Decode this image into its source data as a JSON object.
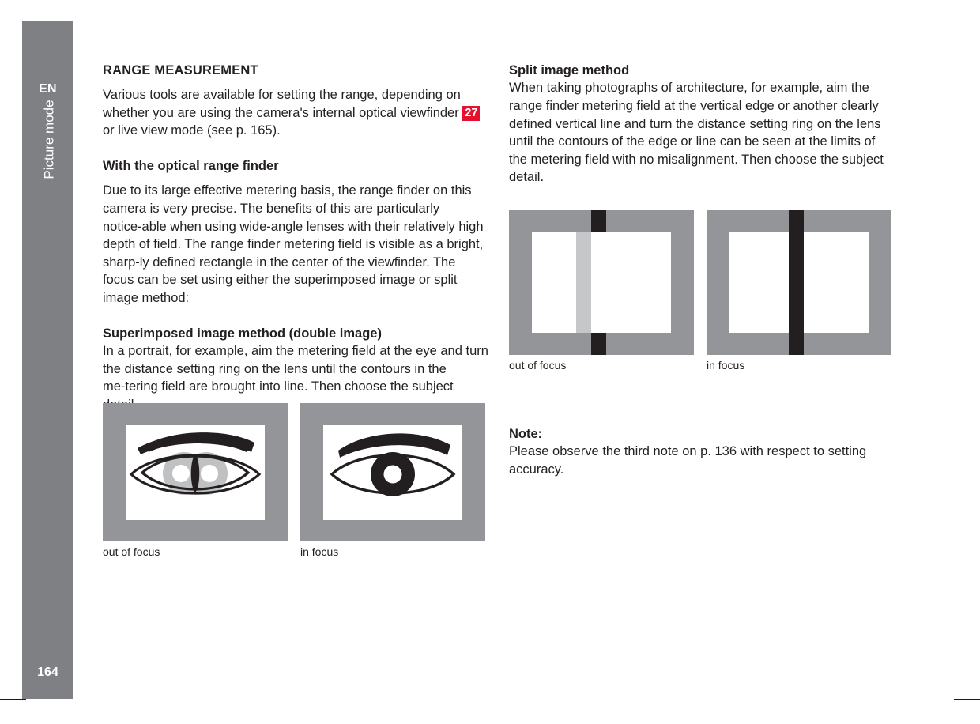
{
  "sidebar": {
    "language": "EN",
    "chapter": "Picture mode",
    "page_number": "164",
    "color": "#7e8083"
  },
  "colors": {
    "accent_red": "#e8112d",
    "sidebar_gray": "#7e8083",
    "figure_gray": "#939598",
    "figure_light_gray": "#c6c7c9",
    "figure_black": "#231f20",
    "text": "#231f20"
  },
  "left_column": {
    "section_title": "RANGE MEASUREMENT",
    "intro_part1": "Various tools are available for setting the range, depending on whether you are using the camera's internal optical viewfinder ",
    "intro_ref": "27",
    "intro_part2": " or live view mode (see p. 165).",
    "subhead_optical": "With the optical range finder",
    "body_optical": "Due to its large effective metering basis, the range finder on this camera is very precise. The benefits of this are particularly notice‑able when using wide‑angle lenses with their relatively high depth of field. The range finder metering field is visible as a bright, sharp‑ly defined rectangle in the center of the viewfinder. The focus can be set using either the superimposed image or split image method:",
    "subhead_superimposed": "Superimposed image method (double image)",
    "body_superimposed": "In a portrait, for example, aim the metering field at the eye and turn the distance setting ring on the lens until the contours in the me‑tering field are brought into line. Then choose the subject detail."
  },
  "right_column": {
    "subhead_split": "Split image method",
    "body_split": "When taking photographs of architecture, for example, aim the range finder metering field at the vertical edge or another clearly defined vertical line and turn the distance setting ring on the lens until the contours of the edge or line can be seen at the limits of the metering field with no misalignment. Then choose the subject detail.",
    "note_label": "Note:",
    "note_body": "Please observe the third note on p. 136 with respect to setting accuracy."
  },
  "figures": {
    "eye_out_of_focus": {
      "caption": "out of focus",
      "alt": "eye-double-image-out-of-focus"
    },
    "eye_in_focus": {
      "caption": "in focus",
      "alt": "eye-single-image-in-focus"
    },
    "split_out_of_focus": {
      "caption": "out of focus",
      "alt": "split-image-misaligned"
    },
    "split_in_focus": {
      "caption": "in focus",
      "alt": "split-image-aligned"
    }
  }
}
